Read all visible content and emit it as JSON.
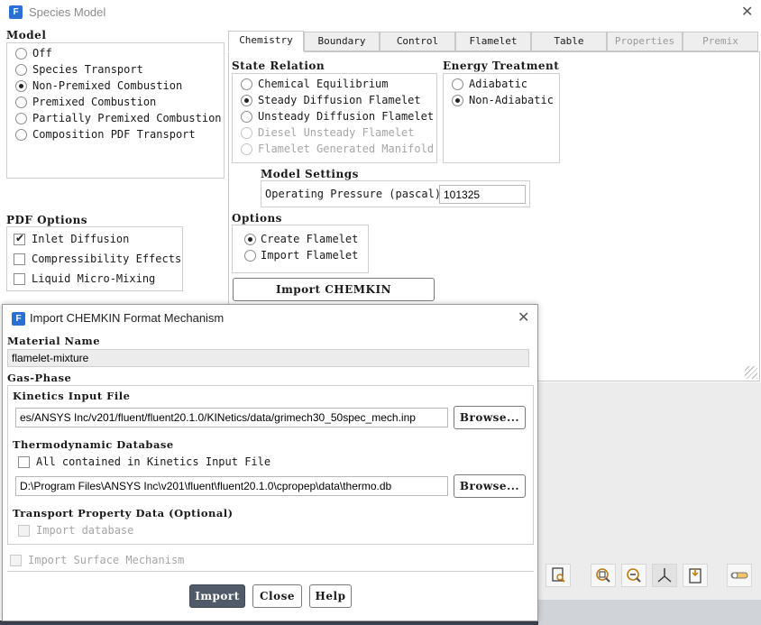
{
  "window": {
    "title": "Species Model",
    "icon_letter": "F"
  },
  "model": {
    "heading": "Model",
    "options": [
      {
        "label": "Off",
        "selected": false
      },
      {
        "label": "Species Transport",
        "selected": false
      },
      {
        "label": "Non-Premixed Combustion",
        "selected": true
      },
      {
        "label": "Premixed Combustion",
        "selected": false
      },
      {
        "label": "Partially Premixed Combustion",
        "selected": false
      },
      {
        "label": "Composition PDF Transport",
        "selected": false
      }
    ]
  },
  "pdf_options": {
    "heading": "PDF Options",
    "items": [
      {
        "label": "Inlet Diffusion",
        "checked": true
      },
      {
        "label": "Compressibility Effects",
        "checked": false
      },
      {
        "label": "Liquid Micro-Mixing",
        "checked": false
      }
    ]
  },
  "tabs": [
    {
      "label": "Chemistry",
      "active": true,
      "enabled": true
    },
    {
      "label": "Boundary",
      "active": false,
      "enabled": true
    },
    {
      "label": "Control",
      "active": false,
      "enabled": true
    },
    {
      "label": "Flamelet",
      "active": false,
      "enabled": true
    },
    {
      "label": "Table",
      "active": false,
      "enabled": true
    },
    {
      "label": "Properties",
      "active": false,
      "enabled": false
    },
    {
      "label": "Premix",
      "active": false,
      "enabled": false
    }
  ],
  "state_relation": {
    "heading": "State Relation",
    "options": [
      {
        "label": "Chemical Equilibrium",
        "selected": false,
        "enabled": true
      },
      {
        "label": "Steady Diffusion Flamelet",
        "selected": true,
        "enabled": true
      },
      {
        "label": "Unsteady Diffusion Flamelet",
        "selected": false,
        "enabled": true
      },
      {
        "label": "Diesel Unsteady Flamelet",
        "selected": false,
        "enabled": false
      },
      {
        "label": "Flamelet Generated Manifold",
        "selected": false,
        "enabled": false
      }
    ]
  },
  "energy_treatment": {
    "heading": "Energy Treatment",
    "options": [
      {
        "label": "Adiabatic",
        "selected": false
      },
      {
        "label": "Non-Adiabatic",
        "selected": true
      }
    ]
  },
  "model_settings": {
    "heading": "Model Settings",
    "pressure_label": "Operating Pressure (pascal)",
    "pressure_value": "101325"
  },
  "options": {
    "heading": "Options",
    "items": [
      {
        "label": "Create Flamelet",
        "selected": true
      },
      {
        "label": "Import Flamelet",
        "selected": false
      }
    ],
    "import_button": "Import CHEMKIN Mechanism..."
  },
  "dialog": {
    "title": "Import CHEMKIN Format Mechanism",
    "icon_letter": "F",
    "material_name_label": "Material Name",
    "material_name_value": "flamelet-mixture",
    "gas_phase_label": "Gas-Phase",
    "kinetics_label": "Kinetics Input File",
    "kinetics_value": "es/ANSYS Inc/v201/fluent/fluent20.1.0/KINetics/data/grimech30_50spec_mech.inp",
    "browse_label": "Browse...",
    "thermo_label": "Thermodynamic Database",
    "thermo_checkbox": "All contained in Kinetics Input File",
    "thermo_value": "D:\\Program Files\\ANSYS Inc\\v201\\fluent\\fluent20.1.0\\cpropep\\data\\thermo.db",
    "transport_label": "Transport Property Data (Optional)",
    "import_database": "Import database",
    "import_surface": "Import Surface Mechanism",
    "buttons": {
      "import": "Import",
      "close": "Close",
      "help": "Help"
    }
  },
  "toolbar_icons": [
    "page-search-icon",
    "zoom-in-icon",
    "zoom-out-icon",
    "axes-icon",
    "export-icon",
    "toggle-icon"
  ]
}
